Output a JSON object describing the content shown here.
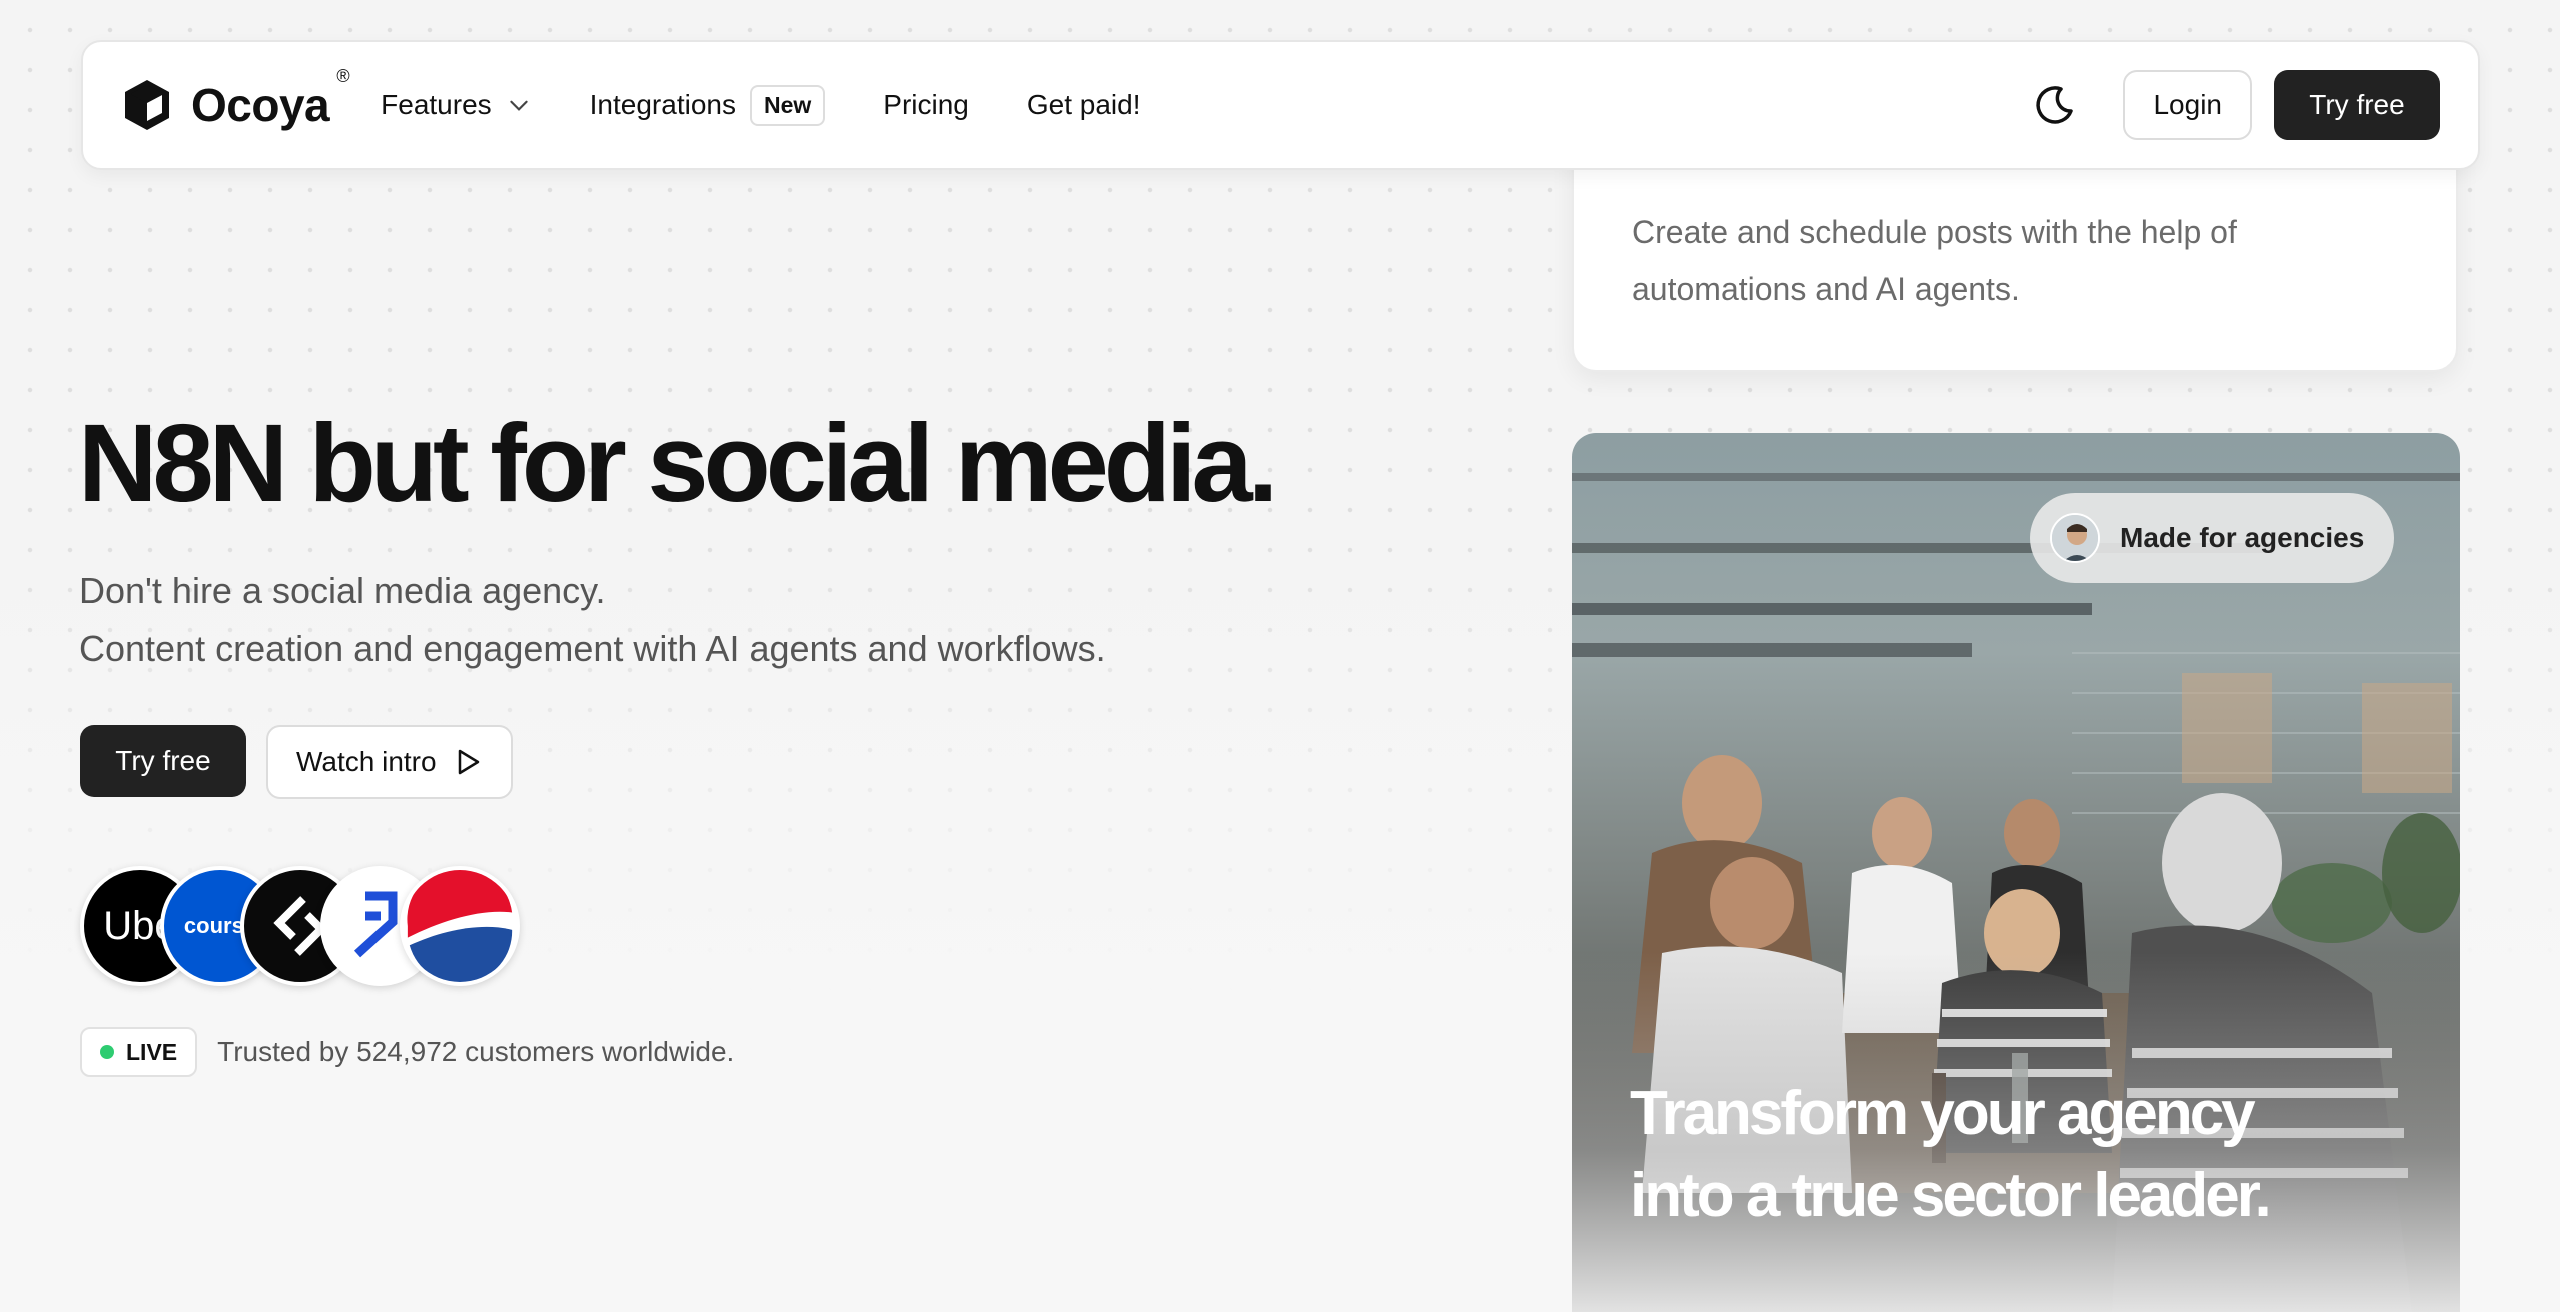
{
  "nav": {
    "brand": "Ocoya",
    "brand_mark": "®",
    "links": [
      {
        "label": "Features"
      },
      {
        "label": "Integrations",
        "badge": "New"
      },
      {
        "label": "Pricing"
      },
      {
        "label": "Get paid!"
      }
    ],
    "login_label": "Login",
    "try_label": "Try free",
    "theme_icon": "moon-icon"
  },
  "top_card": {
    "text": "Create and schedule posts with the help of automations and AI agents."
  },
  "hero": {
    "title": "N8N but for social media.",
    "subtitle_line1": "Don't hire a social media agency.",
    "subtitle_line2": "Content creation and engagement with AI agents and workflows.",
    "try_label": "Try free",
    "watch_label": "Watch intro"
  },
  "customer_logos": [
    {
      "name": "uber",
      "text": "Ube"
    },
    {
      "name": "coursera",
      "text": "course"
    },
    {
      "name": "klaviyo",
      "text": ""
    },
    {
      "name": "arrow",
      "text": ""
    },
    {
      "name": "pepsi",
      "text": ""
    }
  ],
  "live": {
    "badge": "LIVE",
    "text": "Trusted by 524,972 customers worldwide."
  },
  "photo_card": {
    "pill_label": "Made for agencies",
    "headline_line1": "Transform your agency",
    "headline_line2": "into a true sector leader."
  },
  "colors": {
    "accent_dark": "#222222",
    "live_green": "#2ecc71",
    "background": "#f4f4f4"
  }
}
